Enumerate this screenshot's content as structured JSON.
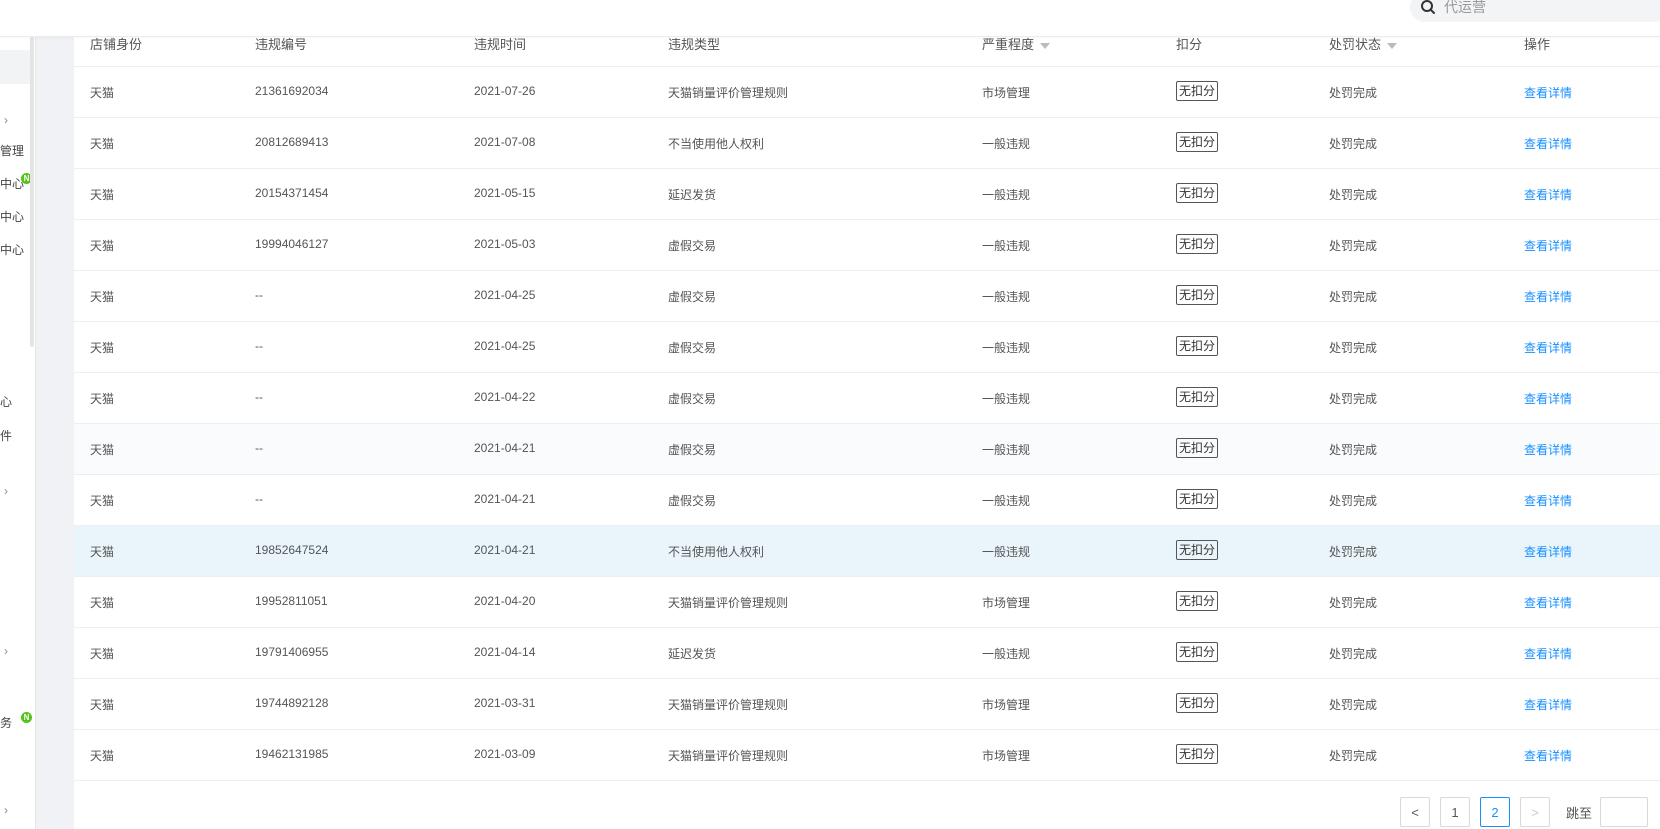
{
  "search": {
    "placeholder": "代运营"
  },
  "sidebar": {
    "items": [
      {
        "label": "管理"
      },
      {
        "label": "中心",
        "badge": "N"
      },
      {
        "label": "中心"
      },
      {
        "label": "中心"
      },
      {
        "label": "心"
      },
      {
        "label": "件"
      },
      {
        "label": "务",
        "badge": "N"
      }
    ]
  },
  "table": {
    "headers": [
      "店铺身份",
      "违规编号",
      "违规时间",
      "违规类型",
      "严重程度",
      "扣分",
      "处罚状态",
      "操作"
    ],
    "rows": [
      {
        "shop": "天猫",
        "id": "21361692034",
        "date": "2021-07-26",
        "type": "天猫销量评价管理规则",
        "severity": "市场管理",
        "points": "无扣分",
        "status": "处罚完成",
        "action": "查看详情"
      },
      {
        "shop": "天猫",
        "id": "20812689413",
        "date": "2021-07-08",
        "type": "不当使用他人权利",
        "severity": "一般违规",
        "points": "无扣分",
        "status": "处罚完成",
        "action": "查看详情"
      },
      {
        "shop": "天猫",
        "id": "20154371454",
        "date": "2021-05-15",
        "type": "延迟发货",
        "severity": "一般违规",
        "points": "无扣分",
        "status": "处罚完成",
        "action": "查看详情"
      },
      {
        "shop": "天猫",
        "id": "19994046127",
        "date": "2021-05-03",
        "type": "虚假交易",
        "severity": "一般违规",
        "points": "无扣分",
        "status": "处罚完成",
        "action": "查看详情"
      },
      {
        "shop": "天猫",
        "id": "--",
        "date": "2021-04-25",
        "type": "虚假交易",
        "severity": "一般违规",
        "points": "无扣分",
        "status": "处罚完成",
        "action": "查看详情"
      },
      {
        "shop": "天猫",
        "id": "--",
        "date": "2021-04-25",
        "type": "虚假交易",
        "severity": "一般违规",
        "points": "无扣分",
        "status": "处罚完成",
        "action": "查看详情"
      },
      {
        "shop": "天猫",
        "id": "--",
        "date": "2021-04-22",
        "type": "虚假交易",
        "severity": "一般违规",
        "points": "无扣分",
        "status": "处罚完成",
        "action": "查看详情"
      },
      {
        "shop": "天猫",
        "id": "--",
        "date": "2021-04-21",
        "type": "虚假交易",
        "severity": "一般违规",
        "points": "无扣分",
        "status": "处罚完成",
        "action": "查看详情"
      },
      {
        "shop": "天猫",
        "id": "--",
        "date": "2021-04-21",
        "type": "虚假交易",
        "severity": "一般违规",
        "points": "无扣分",
        "status": "处罚完成",
        "action": "查看详情"
      },
      {
        "shop": "天猫",
        "id": "19852647524",
        "date": "2021-04-21",
        "type": "不当使用他人权利",
        "severity": "一般违规",
        "points": "无扣分",
        "status": "处罚完成",
        "action": "查看详情"
      },
      {
        "shop": "天猫",
        "id": "19952811051",
        "date": "2021-04-20",
        "type": "天猫销量评价管理规则",
        "severity": "市场管理",
        "points": "无扣分",
        "status": "处罚完成",
        "action": "查看详情"
      },
      {
        "shop": "天猫",
        "id": "19791406955",
        "date": "2021-04-14",
        "type": "延迟发货",
        "severity": "一般违规",
        "points": "无扣分",
        "status": "处罚完成",
        "action": "查看详情"
      },
      {
        "shop": "天猫",
        "id": "19744892128",
        "date": "2021-03-31",
        "type": "天猫销量评价管理规则",
        "severity": "市场管理",
        "points": "无扣分",
        "status": "处罚完成",
        "action": "查看详情"
      },
      {
        "shop": "天猫",
        "id": "19462131985",
        "date": "2021-03-09",
        "type": "天猫销量评价管理规则",
        "severity": "市场管理",
        "points": "无扣分",
        "status": "处罚完成",
        "action": "查看详情"
      }
    ]
  },
  "pagination": {
    "prev": "<",
    "pages": [
      "1",
      "2"
    ],
    "current": "2",
    "next": ">",
    "jump_label": "跳至"
  },
  "colors": {
    "link": "#1890ff",
    "badge_new": "#52c41a",
    "highlight_row": "#e9f5fb"
  }
}
